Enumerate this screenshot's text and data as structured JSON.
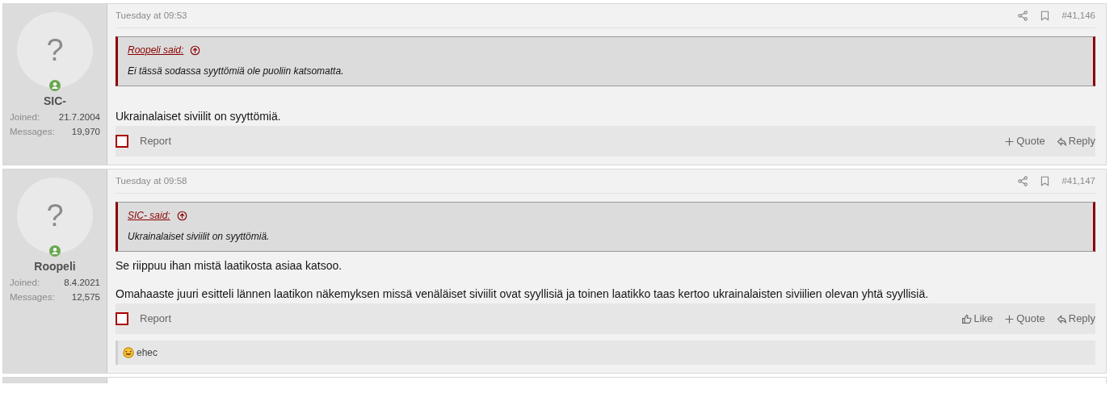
{
  "posts": [
    {
      "user": {
        "avatar": "?",
        "name": "SIC-",
        "online": true,
        "stats": [
          {
            "label": "Joined:",
            "value": "21.7.2004"
          },
          {
            "label": "Messages:",
            "value": "19,970"
          }
        ]
      },
      "date": "Tuesday at 09:53",
      "number": "#41,146",
      "quote": {
        "author": "Roopeli said:",
        "text": "Ei tässä sodassa syyttömiä ole puoliin katsomatta."
      },
      "paragraphs": [
        "Ukrainalaiset siviilit on syyttömiä."
      ],
      "selected": false,
      "report": "Report",
      "actions": [
        {
          "kind": "quote",
          "label": "Quote"
        },
        {
          "kind": "reply",
          "label": "Reply"
        }
      ]
    },
    {
      "user": {
        "avatar": "?",
        "name": "Roopeli",
        "online": true,
        "stats": [
          {
            "label": "Joined:",
            "value": "8.4.2021"
          },
          {
            "label": "Messages:",
            "value": "12,575"
          }
        ]
      },
      "date": "Tuesday at 09:58",
      "number": "#41,147",
      "quote": {
        "author": "SIC- said:",
        "text": "Ukrainalaiset siviilit on syyttömiä."
      },
      "paragraphs": [
        "Se riippuu ihan mistä laatikosta asiaa katsoo.",
        "Omahaaste juuri esitteli lännen laatikon näkemyksen missä venäläiset siviilit ovat syyllisiä ja toinen laatikko taas kertoo ukrainalaisten siviilien olevan yhtä syyllisiä."
      ],
      "selected": false,
      "report": "Report",
      "actions": [
        {
          "kind": "like",
          "label": "Like"
        },
        {
          "kind": "quote",
          "label": "Quote"
        },
        {
          "kind": "reply",
          "label": "Reply"
        }
      ],
      "reactions": "ehec"
    }
  ]
}
